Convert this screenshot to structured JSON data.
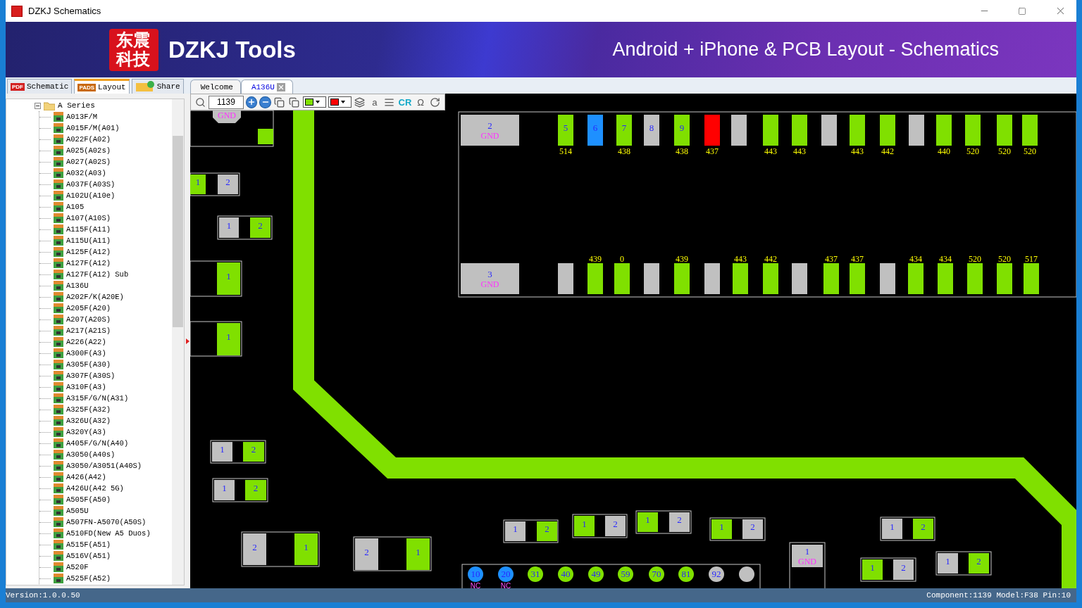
{
  "window": {
    "title": "DZKJ Schematics"
  },
  "banner": {
    "logo_text": "东震科技",
    "brand": "DZKJ Tools",
    "tagline": "Android + iPhone & PCB Layout - Schematics"
  },
  "mode_tabs": [
    {
      "label": "Schematic",
      "icon_text": "PDF",
      "selected": false
    },
    {
      "label": "Layout",
      "icon_text": "PADS",
      "selected": true
    },
    {
      "label": "Share",
      "selected": false
    }
  ],
  "doc_tabs": [
    {
      "label": "Welcome",
      "selected": false,
      "closable": false
    },
    {
      "label": "A136U",
      "selected": true,
      "closable": true
    }
  ],
  "toolbar": {
    "zoom": "1139",
    "swatches": [
      {
        "color": "#80e000"
      },
      {
        "color": "#ff0000"
      }
    ],
    "glyph_buttons": [
      "a",
      "CR",
      "Ω"
    ]
  },
  "tree": {
    "label": "A Series",
    "expanded": true,
    "children": [
      {
        "label": "A013F/M"
      },
      {
        "label": "A015F/M(A01)"
      },
      {
        "label": "A022F(A02)"
      },
      {
        "label": "A025(A02s)"
      },
      {
        "label": "A027(A02S)"
      },
      {
        "label": "A032(A03)"
      },
      {
        "label": "A037F(A03S)"
      },
      {
        "label": "A102U(A10e)"
      },
      {
        "label": "A105"
      },
      {
        "label": "A107(A10S)"
      },
      {
        "label": "A115F(A11)"
      },
      {
        "label": "A115U(A11)"
      },
      {
        "label": "A125F(A12)"
      },
      {
        "label": "A127F(A12)"
      },
      {
        "label": "A127F(A12) Sub"
      },
      {
        "label": "A136U"
      },
      {
        "label": "A202F/K(A20E)"
      },
      {
        "label": "A205F(A20)"
      },
      {
        "label": "A207(A20S)"
      },
      {
        "label": "A217(A21S)"
      },
      {
        "label": "A226(A22)"
      },
      {
        "label": "A300F(A3)"
      },
      {
        "label": "A305F(A30)"
      },
      {
        "label": "A307F(A30S)"
      },
      {
        "label": "A310F(A3)"
      },
      {
        "label": "A315F/G/N(A31)"
      },
      {
        "label": "A325F(A32)"
      },
      {
        "label": "A326U(A32)"
      },
      {
        "label": "A320Y(A3)"
      },
      {
        "label": "A405F/G/N(A40)"
      },
      {
        "label": "A3050(A40s)"
      },
      {
        "label": "A3050/A3051(A40S)"
      },
      {
        "label": "A426(A42)"
      },
      {
        "label": "A426U(A42 5G)"
      },
      {
        "label": "A505F(A50)"
      },
      {
        "label": "A505U"
      },
      {
        "label": "A507FN-A5070(A50S)"
      },
      {
        "label": "A510FD(New A5 Duos)"
      },
      {
        "label": "A515F(A51)"
      },
      {
        "label": "A516V(A51)"
      },
      {
        "label": "A520F"
      },
      {
        "label": "A525F(A52)"
      }
    ]
  },
  "canvas": {
    "connector": {
      "gnd_pads": [
        {
          "pin": "2",
          "net": "GND",
          "color": "#c0c0c0"
        },
        {
          "pin": "3",
          "net": "GND",
          "color": "#c0c0c0"
        }
      ],
      "top_pins": [
        {
          "pin": "5",
          "net": "514",
          "color": "#80e000"
        },
        {
          "pin": "6",
          "color": "#1e90ff"
        },
        {
          "pin": "7",
          "net": "438",
          "color": "#80e000"
        },
        {
          "pin": "8",
          "color": "#c0c0c0"
        },
        {
          "pin": "9",
          "net": "438",
          "color": "#80e000"
        },
        {
          "net": "437",
          "color": "#ff0000"
        },
        {
          "color": "#c0c0c0"
        },
        {
          "net": "443",
          "color": "#80e000"
        },
        {
          "net": "443",
          "color": "#80e000"
        },
        {
          "color": "#c0c0c0"
        },
        {
          "net": "443",
          "color": "#80e000"
        },
        {
          "net": "442",
          "color": "#80e000"
        },
        {
          "color": "#c0c0c0"
        },
        {
          "net": "440",
          "color": "#80e000"
        },
        {
          "net": "520",
          "color": "#80e000"
        },
        {
          "net": "520",
          "color": "#80e000"
        },
        {
          "net": "520",
          "color": "#80e000"
        }
      ],
      "bottom_pins": [
        {
          "color": "#c0c0c0"
        },
        {
          "net": "439",
          "color": "#80e000"
        },
        {
          "net": "0",
          "color": "#80e000"
        },
        {
          "color": "#c0c0c0"
        },
        {
          "net": "439",
          "color": "#80e000"
        },
        {
          "color": "#c0c0c0"
        },
        {
          "net": "443",
          "color": "#80e000"
        },
        {
          "net": "442",
          "color": "#80e000"
        },
        {
          "color": "#c0c0c0"
        },
        {
          "net": "437",
          "color": "#80e000"
        },
        {
          "net": "437",
          "color": "#80e000"
        },
        {
          "color": "#c0c0c0"
        },
        {
          "net": "434",
          "color": "#80e000"
        },
        {
          "net": "434",
          "color": "#80e000"
        },
        {
          "net": "520",
          "color": "#80e000"
        },
        {
          "net": "520",
          "color": "#80e000"
        },
        {
          "net": "517",
          "color": "#80e000"
        }
      ]
    },
    "parts": [
      {
        "pads": [
          {
            "net": "GND",
            "color": "#c0c0c0"
          },
          {
            "color": "#80e000"
          }
        ]
      },
      {
        "pads": [
          {
            "pin": "1",
            "color": "#80e000"
          },
          {
            "pin": "2",
            "color": "#c0c0c0"
          }
        ]
      },
      {
        "pads": [
          {
            "pin": "1",
            "color": "#c0c0c0"
          },
          {
            "pin": "2",
            "color": "#80e000"
          }
        ]
      },
      {
        "pads": [
          {
            "pin": "1",
            "color": "#80e000"
          }
        ]
      },
      {
        "pads": [
          {
            "pin": "1",
            "color": "#80e000"
          }
        ]
      },
      {
        "pads": [
          {
            "pin": "1",
            "color": "#c0c0c0"
          },
          {
            "pin": "2",
            "color": "#80e000"
          }
        ]
      },
      {
        "pads": [
          {
            "pin": "1",
            "color": "#c0c0c0"
          },
          {
            "pin": "2",
            "color": "#80e000"
          }
        ]
      },
      {
        "pads": [
          {
            "pin": "2",
            "color": "#c0c0c0"
          },
          {
            "pin": "1",
            "color": "#80e000"
          }
        ]
      },
      {
        "pads": [
          {
            "pin": "2",
            "color": "#c0c0c0"
          },
          {
            "pin": "1",
            "color": "#80e000"
          }
        ]
      },
      {
        "pads": [
          {
            "pin": "1",
            "color": "#c0c0c0"
          },
          {
            "pin": "2",
            "color": "#80e000"
          }
        ]
      },
      {
        "pads": [
          {
            "pin": "1",
            "color": "#80e000"
          },
          {
            "pin": "2",
            "color": "#c0c0c0"
          }
        ]
      },
      {
        "pads": [
          {
            "pin": "1",
            "color": "#80e000"
          },
          {
            "pin": "2",
            "color": "#c0c0c0"
          }
        ]
      },
      {
        "pads": [
          {
            "pin": "1",
            "color": "#80e000"
          },
          {
            "pin": "2",
            "color": "#c0c0c0"
          }
        ]
      },
      {
        "pads": [
          {
            "pin": "1",
            "color": "#c0c0c0"
          },
          {
            "pin": "2",
            "color": "#80e000"
          }
        ]
      },
      {
        "pads": [
          {
            "pin": "1",
            "color": "#80e000"
          },
          {
            "pin": "2",
            "color": "#c0c0c0"
          }
        ]
      },
      {
        "pads": [
          {
            "pin": "1",
            "color": "#c0c0c0"
          },
          {
            "pin": "2",
            "color": "#80e000"
          }
        ]
      },
      {
        "pads": [
          {
            "pin": "1",
            "net": "GND",
            "color": "#c0c0c0"
          }
        ]
      }
    ],
    "test_points": [
      {
        "pin": "10",
        "net": "NC",
        "color": "#1e90ff"
      },
      {
        "pin": "20",
        "net": "NC",
        "color": "#1e90ff"
      },
      {
        "pin": "31",
        "color": "#80e000"
      },
      {
        "pin": "40",
        "color": "#80e000"
      },
      {
        "pin": "49",
        "color": "#80e000"
      },
      {
        "pin": "59",
        "color": "#80e000"
      },
      {
        "pin": "70",
        "color": "#80e000"
      },
      {
        "pin": "81",
        "color": "#80e000"
      },
      {
        "pin": "92",
        "color": "#c0c0c0"
      },
      {
        "color": "#c0c0c0"
      }
    ]
  },
  "status_bar": {
    "version": "Version:1.0.0.50",
    "info": "Component:1139 Model:F38 Pin:10"
  }
}
